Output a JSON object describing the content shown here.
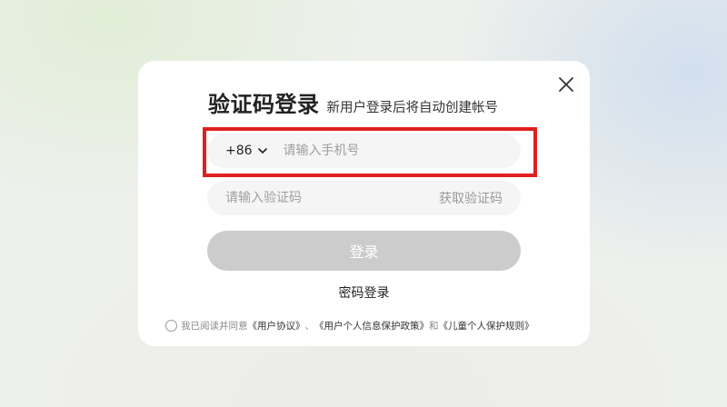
{
  "modal": {
    "title": "验证码登录",
    "subtitle": "新用户登录后将自动创建帐号",
    "phone": {
      "country_code": "+86",
      "placeholder": "请输入手机号"
    },
    "code": {
      "placeholder": "请输入验证码",
      "get_code_label": "获取验证码"
    },
    "login_button": "登录",
    "password_login": "密码登录",
    "agreement": {
      "prefix": "我已阅读并同意",
      "user_agreement": "《用户协议》",
      "sep1": "、",
      "privacy_policy": "《用户个人信息保护政策》",
      "sep2": "和",
      "child_policy": "《儿童个人保护规则》"
    }
  },
  "colors": {
    "highlight": "#e02020",
    "login_button_bg": "#cccccc"
  }
}
